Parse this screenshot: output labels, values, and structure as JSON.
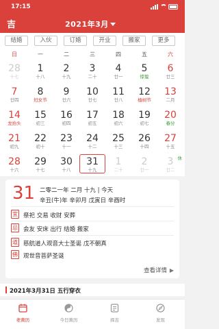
{
  "status": {
    "time": "17:15"
  },
  "header": {
    "logo": "吉",
    "month": "2021年3月"
  },
  "filters": [
    "结婚",
    "入伙",
    "订婚",
    "开业",
    "搬家",
    "更多"
  ],
  "weekdays": [
    "日",
    "一",
    "二",
    "三",
    "四",
    "五",
    "六"
  ],
  "weeks": [
    [
      {
        "num": "28",
        "sub": "十七",
        "faded": true
      },
      {
        "num": "1",
        "sub": "十八"
      },
      {
        "num": "2",
        "sub": "十九"
      },
      {
        "num": "3",
        "sub": "二十"
      },
      {
        "num": "4",
        "sub": "廿一"
      },
      {
        "num": "5",
        "sub": "惊蛰",
        "sub_color": "green"
      },
      {
        "num": "6",
        "sub": "廿三"
      }
    ],
    [
      {
        "num": "7",
        "sub": "廿四"
      },
      {
        "num": "8",
        "sub": "妇女节",
        "sub_color": "red"
      },
      {
        "num": "9",
        "sub": "廿六"
      },
      {
        "num": "10",
        "sub": "廿七"
      },
      {
        "num": "11",
        "sub": "廿八"
      },
      {
        "num": "12",
        "sub": "植树节",
        "sub_color": "red"
      },
      {
        "num": "13",
        "sub": "二月"
      }
    ],
    [
      {
        "num": "14",
        "sub": "龙抬头",
        "sub_color": "red"
      },
      {
        "num": "15",
        "sub": "初三"
      },
      {
        "num": "16",
        "sub": "初四"
      },
      {
        "num": "17",
        "sub": "初五"
      },
      {
        "num": "18",
        "sub": "初六"
      },
      {
        "num": "19",
        "sub": "初七"
      },
      {
        "num": "20",
        "sub": "春分",
        "sub_color": "green"
      }
    ],
    [
      {
        "num": "21",
        "sub": "初九"
      },
      {
        "num": "22",
        "sub": "初十"
      },
      {
        "num": "23",
        "sub": "十一"
      },
      {
        "num": "24",
        "sub": "十二"
      },
      {
        "num": "25",
        "sub": "十三"
      },
      {
        "num": "26",
        "sub": "十四"
      },
      {
        "num": "27",
        "sub": "十五"
      }
    ],
    [
      {
        "num": "28",
        "sub": "十六"
      },
      {
        "num": "29",
        "sub": "十七"
      },
      {
        "num": "30",
        "sub": "十八"
      },
      {
        "num": "31",
        "sub": "十九",
        "selected": true
      },
      {
        "num": "1",
        "sub": "二十",
        "faded": true
      },
      {
        "num": "2",
        "sub": "廿一",
        "faded": true
      },
      {
        "num": "3",
        "sub": "廿二",
        "faded": true,
        "mark": "休"
      }
    ]
  ],
  "detail": {
    "day": "31",
    "line1": "二零二一年 二月 十九 | 今天",
    "line2": "辛丑(牛)年 辛卯月 戊寅日 辛酉时",
    "yi_tag": "宜",
    "yi_text": "祭祀 交易 收财 安葬",
    "ji_tag": "忌",
    "ji_text": "会友 安床 出行 结婚 搬家",
    "dao_tag": "道",
    "dao_text": "慈航道人观音大士圣诞 戊不朝真",
    "fo_tag": "佛",
    "fo_text": "观世音菩萨圣诞",
    "more": "查看详情",
    "more_arrow": "▶"
  },
  "section": {
    "title": "2021年3月31日 五行穿衣"
  },
  "tabs": [
    {
      "label": "老黄历",
      "icon": "calendar-icon"
    },
    {
      "label": "今日黄历",
      "icon": "yin-yang-icon"
    },
    {
      "label": "择吉",
      "icon": "select-date-icon"
    },
    {
      "label": "发现",
      "icon": "compass-icon"
    }
  ],
  "colors": {
    "accent": "#d9413a",
    "holiday_green": "#3a9b3a"
  }
}
